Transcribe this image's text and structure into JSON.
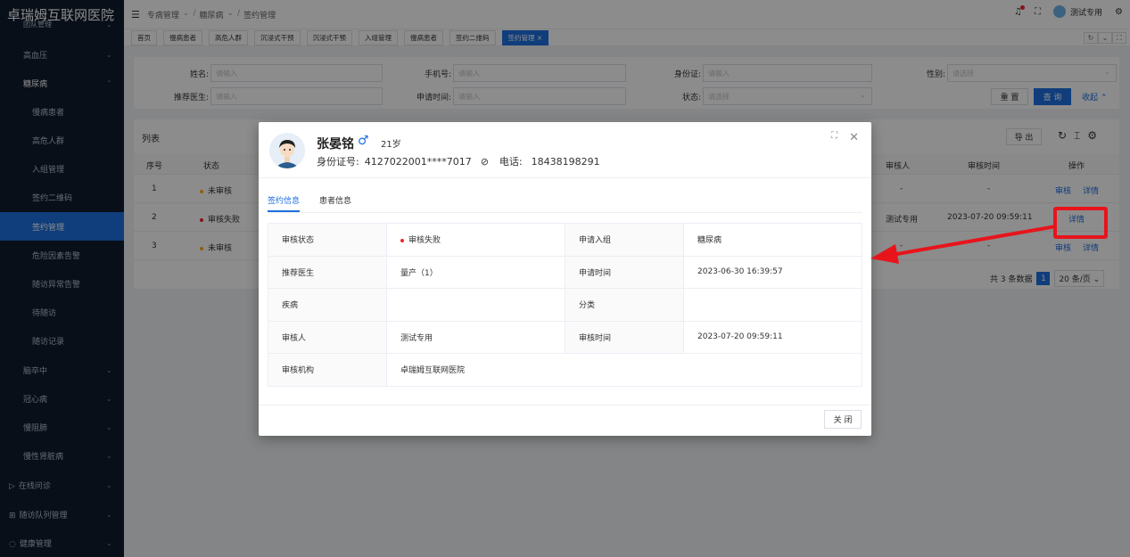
{
  "app": {
    "title": "卓瑞姆互联网医院"
  },
  "sidebar": {
    "items": [
      {
        "label": "团队管理",
        "top": true
      },
      {
        "label": "高血压"
      },
      {
        "label": "糖尿病"
      },
      {
        "label": "慢病患者"
      },
      {
        "label": "高危人群"
      },
      {
        "label": "入组管理"
      },
      {
        "label": "签约二维码"
      },
      {
        "label": "签约管理"
      },
      {
        "label": "危险因素告警"
      },
      {
        "label": "随访异常告警"
      },
      {
        "label": "待随访"
      },
      {
        "label": "随访记录"
      },
      {
        "label": "脑卒中"
      },
      {
        "label": "冠心病"
      },
      {
        "label": "慢阻肺"
      },
      {
        "label": "慢性肾脏病"
      },
      {
        "label": "在线问诊"
      },
      {
        "label": "随访队列管理"
      },
      {
        "label": "健康管理"
      }
    ]
  },
  "header": {
    "breadcrumb": [
      "专病管理",
      "糖尿病",
      "签约管理"
    ],
    "user_name": "测试专用"
  },
  "tabs": [
    "首页",
    "慢病患者",
    "高危人群",
    "沉浸式干预",
    "沉浸式干预",
    "入组管理",
    "慢病患者",
    "签约二维码",
    "签约管理"
  ],
  "search": {
    "name_label": "姓名:",
    "name_placeholder": "请输入",
    "phone_label": "手机号:",
    "phone_placeholder": "请输入",
    "id_label": "身份证:",
    "id_placeholder": "请输入",
    "gender_label": "性别:",
    "gender_placeholder": "请选择",
    "doctor_label": "推荐医生:",
    "doctor_placeholder": "请输入",
    "apply_time_label": "申请时间:",
    "apply_time_placeholder": "请输入",
    "status_label": "状态:",
    "status_placeholder": "请选择",
    "reset": "重 置",
    "query": "查 询",
    "collapse": "收起"
  },
  "table": {
    "title": "列表",
    "export": "导 出",
    "headers": {
      "index": "序号",
      "status": "状态",
      "auditor": "审核人",
      "audit_time": "审核时间",
      "action": "操作"
    },
    "rows": [
      {
        "index": "1",
        "status": "未审核",
        "auditor": "-",
        "audit_time": "-",
        "audit": "审核",
        "detail": "详情"
      },
      {
        "index": "2",
        "status": "审核失败",
        "auditor": "测试专用",
        "audit_time": "2023-07-20 09:59:11",
        "audit": "",
        "detail": "详情"
      },
      {
        "index": "3",
        "status": "未审核",
        "auditor": "-",
        "audit_time": "-",
        "audit": "审核",
        "detail": "详情"
      }
    ],
    "pagination": {
      "total": "共 3 条数据",
      "page": "1",
      "size": "20 条/页"
    }
  },
  "modal": {
    "name": "张晏铭",
    "sex": "♂",
    "age": "21岁",
    "id_label": "身份证号:",
    "id_value": "4127022001****7017",
    "phone_label": "电话:",
    "phone_value": "18438198291",
    "tabs": [
      "签约信息",
      "患者信息"
    ],
    "fields": {
      "audit_status_k": "审核状态",
      "audit_status_v": "审核失败",
      "group_k": "申请入组",
      "group_v": "糖尿病",
      "doctor_k": "推荐医生",
      "doctor_v": "量产（1）",
      "apply_time_k": "申请时间",
      "apply_time_v": "2023-06-30 16:39:57",
      "disease_k": "疾病",
      "disease_v": "",
      "category_k": "分类",
      "category_v": "",
      "auditor_k": "审核人",
      "auditor_v": "测试专用",
      "audit_time_k": "审核时间",
      "audit_time_v": "2023-07-20 09:59:11",
      "org_k": "审核机构",
      "org_v": "卓瑞姆互联网医院"
    },
    "close_button": "关 闭"
  },
  "colors": {
    "primary": "#1e6fe0",
    "sidebar_bg": "#0f1c2e",
    "annotation": "#e8141c"
  }
}
